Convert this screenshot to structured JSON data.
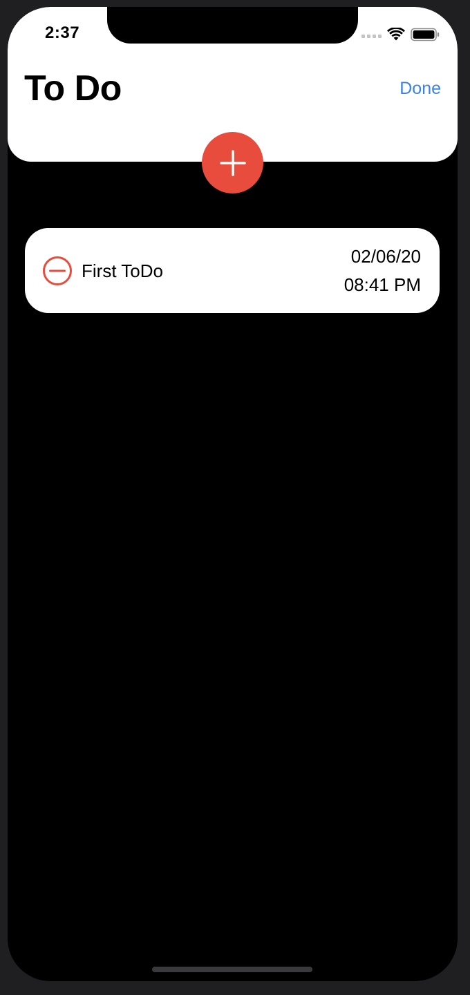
{
  "status_bar": {
    "time": "2:37"
  },
  "header": {
    "title": "To Do",
    "done_label": "Done"
  },
  "todos": [
    {
      "title": "First ToDo",
      "date": "02/06/20",
      "time": "08:41 PM"
    }
  ],
  "icons": {
    "add": "plus-icon",
    "delete": "minus-circle-icon",
    "wifi": "wifi-icon",
    "battery": "battery-icon",
    "signal": "cellular-signal-icon"
  },
  "colors": {
    "accent_red": "#e84c3d",
    "link_blue": "#3b82e6",
    "background": "#000000",
    "card": "#ffffff"
  }
}
